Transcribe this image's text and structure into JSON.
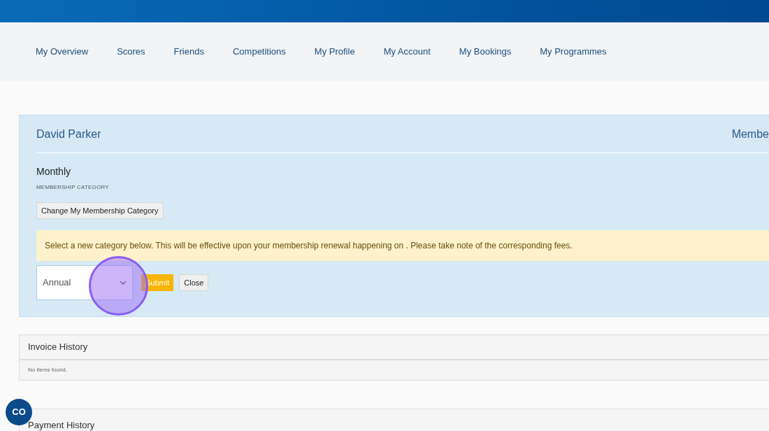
{
  "nav": [
    {
      "label": "My Overview"
    },
    {
      "label": "Scores"
    },
    {
      "label": "Friends"
    },
    {
      "label": "Competitions"
    },
    {
      "label": "My Profile"
    },
    {
      "label": "My Account"
    },
    {
      "label": "My Bookings"
    },
    {
      "label": "My Programmes"
    }
  ],
  "member": {
    "name": "David Parker",
    "right_label": "Membe",
    "category": "Monthly",
    "category_label": "MEMBERSHIP CATEGORY",
    "change_button": "Change My Membership Category",
    "notice": "Select a new category below. This will be effective upon your membership renewal happening on . Please take note of the corresponding fees.",
    "select_value": "Annual",
    "submit_button": "Submit",
    "close_button": "Close"
  },
  "invoice_history": {
    "title": "Invoice History",
    "empty": "No items found."
  },
  "payment_history": {
    "title": "Payment History"
  },
  "chat_button": {
    "label": "CO"
  }
}
